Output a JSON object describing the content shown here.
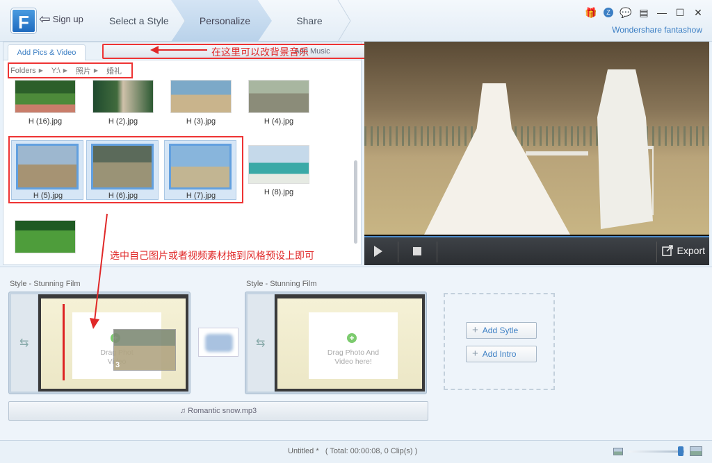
{
  "app": {
    "logo_letter": "F",
    "brand": "Wondershare fantashow",
    "sign_up": "Sign up"
  },
  "steps": [
    "Select a Style",
    "Personalize",
    "Share"
  ],
  "media_panel": {
    "tabs": [
      "Add Pics & Video",
      "Add Music"
    ],
    "breadcrumb": [
      "Folders",
      "Y:\\",
      "照片",
      "婚礼"
    ],
    "thumbnails": [
      "H (16).jpg",
      "H (2).jpg",
      "H (3).jpg",
      "H (4).jpg",
      "H (5).jpg",
      "H (6).jpg",
      "H (7).jpg",
      "H (8).jpg"
    ]
  },
  "preview": {
    "export_label": "Export"
  },
  "storyboard": {
    "slot1_label": "Style - Stunning Film",
    "slot2_label": "Style - Stunning Film",
    "drop_text_1": "Drag Photo And",
    "drop_text_2": "Video here!",
    "drop_partial_1": "Drag Phot",
    "drop_partial_2": "Video",
    "drag_count": "3",
    "add_style": "Add Sytle",
    "add_intro": "Add Intro",
    "music_track": "Romantic snow.mp3"
  },
  "status": {
    "project": "Untitled *",
    "summary": "( Total: 00:00:08, 0 Clip(s) )"
  },
  "annotations": {
    "music_note": "在这里可以改背景音乐",
    "drag_note": "选中自己图片或者视频素材拖到风格预设上即可"
  },
  "colors": {
    "accent": "#3c7fc4",
    "annotation": "#e02828"
  }
}
